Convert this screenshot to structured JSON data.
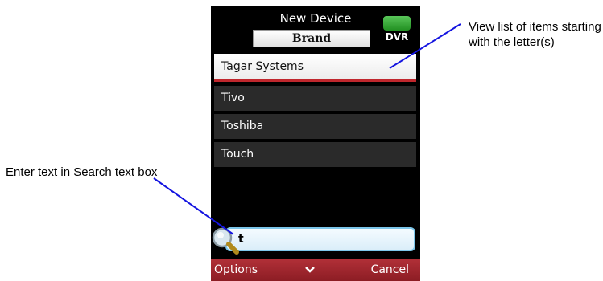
{
  "header": {
    "title": "New Device",
    "subtitle": "Brand",
    "device_badge": "DVR"
  },
  "list": {
    "items": [
      "Tagar Systems",
      "Tivo",
      "Toshiba",
      "Touch"
    ],
    "selected_index": 0
  },
  "search": {
    "value": "t"
  },
  "softkeys": {
    "left": "Options",
    "right": "Cancel",
    "middle_icon": "chevron-down-icon"
  },
  "callouts": {
    "list_note": "View list of items starting with the letter(s)",
    "search_note": "Enter text in Search text box"
  },
  "colors": {
    "softkey_bar": "#a7282f",
    "selection_border": "#c0272d",
    "search_border": "#7cc6ea",
    "badge": "#3bab3b",
    "callout_line": "#1414e0"
  }
}
